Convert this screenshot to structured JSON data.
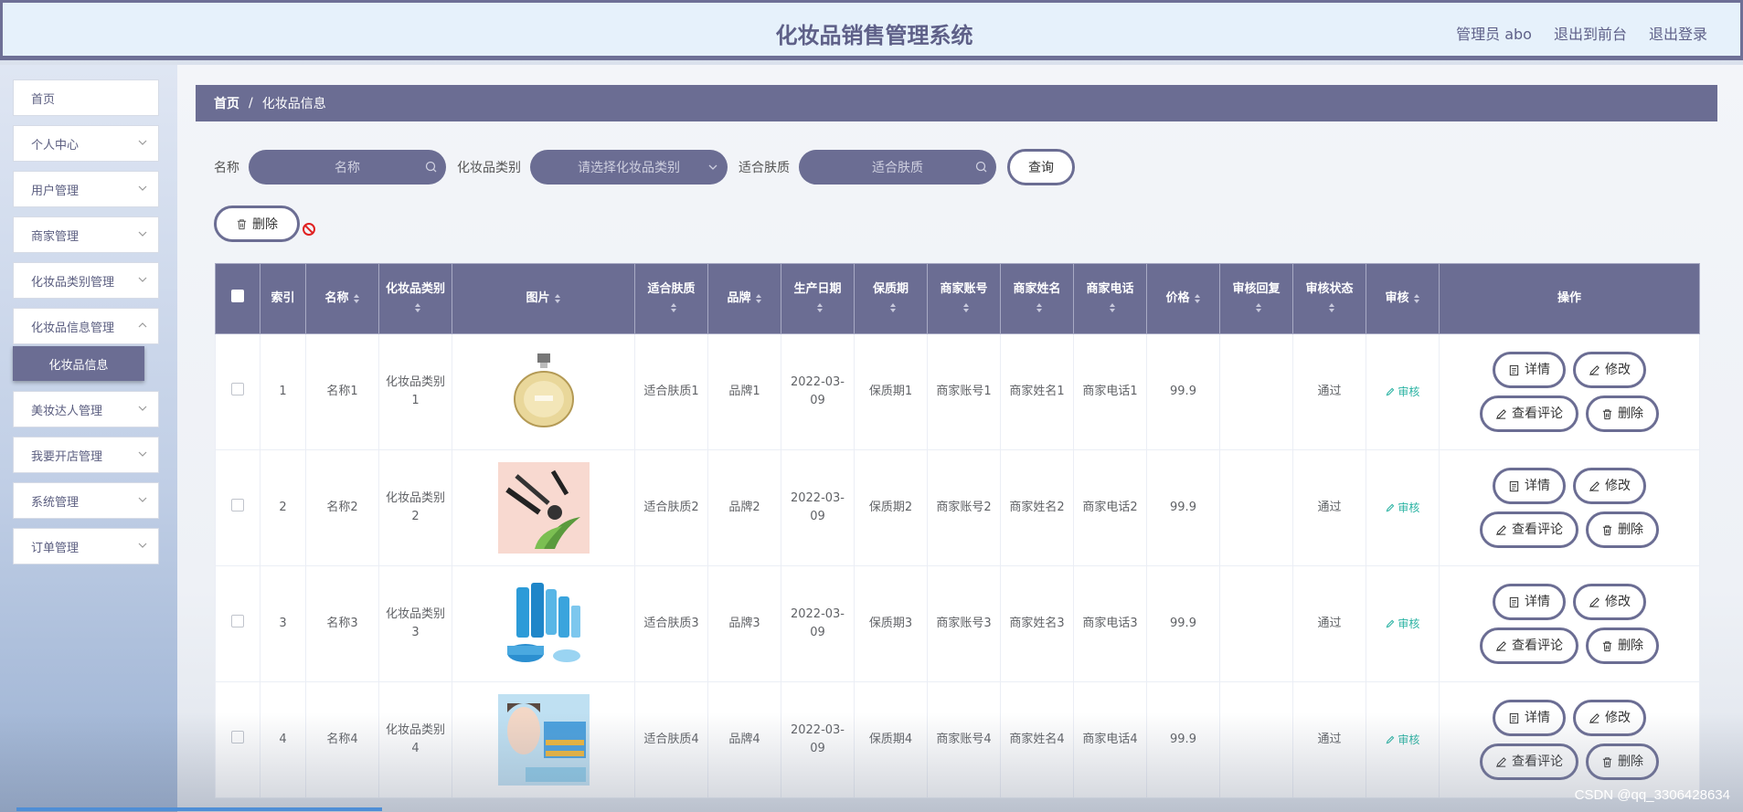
{
  "header": {
    "title": "化妆品销售管理系统",
    "user_label": "管理员 abo",
    "to_front_label": "退出到前台",
    "logout_label": "退出登录"
  },
  "sidebar": {
    "items": [
      {
        "label": "首页",
        "has_chevron": false
      },
      {
        "label": "个人中心",
        "has_chevron": true
      },
      {
        "label": "用户管理",
        "has_chevron": true
      },
      {
        "label": "商家管理",
        "has_chevron": true
      },
      {
        "label": "化妆品类别管理",
        "has_chevron": true
      },
      {
        "label": "化妆品信息管理",
        "has_chevron": true
      },
      {
        "label": "美妆达人管理",
        "has_chevron": true
      },
      {
        "label": "我要开店管理",
        "has_chevron": true
      },
      {
        "label": "系统管理",
        "has_chevron": true
      },
      {
        "label": "订单管理",
        "has_chevron": true
      }
    ],
    "active_sub": "化妆品信息"
  },
  "breadcrumb": {
    "home": "首页",
    "separator": "/",
    "current": "化妆品信息"
  },
  "filters": {
    "name_label": "名称",
    "name_placeholder": "名称",
    "category_label": "化妆品类别",
    "category_placeholder": "请选择化妆品类别",
    "skin_label": "适合肤质",
    "skin_placeholder": "适合肤质",
    "query_label": "查询"
  },
  "toolbar": {
    "delete_label": "删除"
  },
  "table": {
    "columns": [
      "索引",
      "名称",
      "化妆品类别",
      "图片",
      "适合肤质",
      "品牌",
      "生产日期",
      "保质期",
      "商家账号",
      "商家姓名",
      "商家电话",
      "价格",
      "审核回复",
      "审核状态",
      "审核",
      "操作"
    ],
    "rows": [
      {
        "index": "1",
        "name": "名称1",
        "category": "化妆品类别1",
        "image": "perfume-bottle",
        "skin": "适合肤质1",
        "brand": "品牌1",
        "date": "2022-03-09",
        "shelf": "保质期1",
        "account": "商家账号1",
        "merchant": "商家姓名1",
        "phone": "商家电话1",
        "price": "99.9",
        "reply": "",
        "status": "通过",
        "audit": "审核"
      },
      {
        "index": "2",
        "name": "名称2",
        "category": "化妆品类别2",
        "image": "makeup-brushes",
        "skin": "适合肤质2",
        "brand": "品牌2",
        "date": "2022-03-09",
        "shelf": "保质期2",
        "account": "商家账号2",
        "merchant": "商家姓名2",
        "phone": "商家电话2",
        "price": "99.9",
        "reply": "",
        "status": "通过",
        "audit": "审核"
      },
      {
        "index": "3",
        "name": "名称3",
        "category": "化妆品类别3",
        "image": "skincare-set",
        "skin": "适合肤质3",
        "brand": "品牌3",
        "date": "2022-03-09",
        "shelf": "保质期3",
        "account": "商家账号3",
        "merchant": "商家姓名3",
        "phone": "商家电话3",
        "price": "99.9",
        "reply": "",
        "status": "通过",
        "audit": "审核"
      },
      {
        "index": "4",
        "name": "名称4",
        "category": "化妆品类别4",
        "image": "face-mask",
        "skin": "适合肤质4",
        "brand": "品牌4",
        "date": "2022-03-09",
        "shelf": "保质期4",
        "account": "商家账号4",
        "merchant": "商家姓名4",
        "phone": "商家电话4",
        "price": "99.9",
        "reply": "",
        "status": "通过",
        "audit": "审核"
      }
    ],
    "actions": {
      "detail": "详情",
      "edit": "修改",
      "comments": "查看评论",
      "delete": "删除"
    }
  },
  "watermark": "CSDN @qq_3306428634",
  "colors": {
    "accent": "#6b6d93",
    "audit": "#2bb3a3",
    "header_bg": "#e6f1fb"
  }
}
